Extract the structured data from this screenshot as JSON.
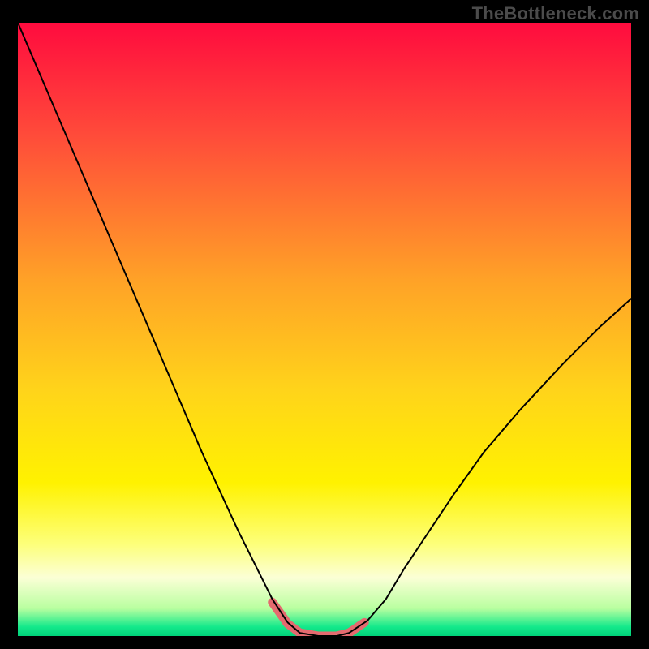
{
  "watermark": "TheBottleneck.com",
  "chart_data": {
    "type": "line",
    "title": "",
    "xlabel": "",
    "ylabel": "",
    "xlim": [
      0,
      100
    ],
    "ylim": [
      0,
      100
    ],
    "grid": false,
    "legend": false,
    "background_gradient": {
      "stops": [
        {
          "offset": 0.0,
          "color": "#ff0b3e"
        },
        {
          "offset": 0.18,
          "color": "#ff4a3a"
        },
        {
          "offset": 0.42,
          "color": "#ffa227"
        },
        {
          "offset": 0.6,
          "color": "#ffd41a"
        },
        {
          "offset": 0.75,
          "color": "#fff200"
        },
        {
          "offset": 0.85,
          "color": "#fdff7a"
        },
        {
          "offset": 0.905,
          "color": "#fbffd6"
        },
        {
          "offset": 0.955,
          "color": "#b9ffa0"
        },
        {
          "offset": 0.985,
          "color": "#14e98b"
        },
        {
          "offset": 1.0,
          "color": "#00d27a"
        }
      ]
    },
    "series": [
      {
        "name": "bottleneck-curve",
        "color": "#000000",
        "width": 2,
        "x": [
          0,
          3,
          6,
          9,
          12,
          15,
          18,
          21,
          24,
          27,
          30,
          33,
          36,
          39,
          41.5,
          44,
          46,
          49,
          52,
          54,
          57,
          60,
          63,
          67,
          71,
          76,
          82,
          89,
          95,
          100
        ],
        "y": [
          100,
          93,
          86,
          79,
          72,
          65,
          58,
          51,
          44,
          37,
          30,
          23.5,
          17,
          11,
          6,
          2.2,
          0.5,
          0,
          0,
          0.5,
          2.5,
          6,
          11,
          17,
          23,
          30,
          37,
          44.5,
          50.5,
          55
        ]
      },
      {
        "name": "goal-band",
        "color": "#e46a6f",
        "width": 11,
        "linecap": "round",
        "x": [
          41.5,
          44,
          46,
          49,
          52,
          54,
          56.5
        ],
        "y": [
          5.5,
          2.0,
          0.5,
          0,
          0,
          0.5,
          2.2
        ]
      }
    ]
  }
}
